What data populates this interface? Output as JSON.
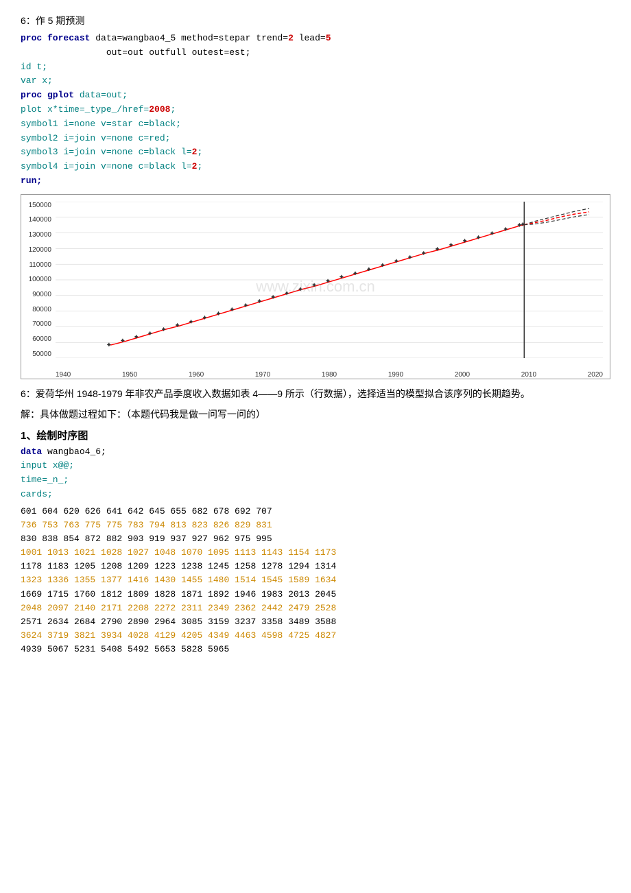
{
  "sections": {
    "section6_title": "6：作 5 期预测",
    "code1": {
      "line1": "proc forecast data=wangbao4_5 method=stepar trend=",
      "line1_val": "2",
      "line1_end": " lead=",
      "line1_val2": "5",
      "line2": "                out=out outfull outest=est;",
      "line3": "id t;",
      "line4": "var x;",
      "line5": "proc gplot data=out;",
      "line6": "plot x*time=_type_/href=",
      "line6_val": "2008",
      "line6_end": ";",
      "line7": "symbol1 i=none v=star c=black;",
      "line8": "symbol2 i=join v=none c=red;",
      "line9": "symbol3 i=join v=none c=black l=",
      "line9_val": "2",
      "line9_end": ";",
      "line10": "symbol4 i=join v=none c=black l=",
      "line10_val": "2",
      "line10_end": ";",
      "line11": "run;"
    },
    "chart": {
      "y_labels": [
        "150000",
        "140000",
        "130000",
        "120000",
        "110000",
        "100000",
        "90000",
        "80000",
        "70000",
        "60000",
        "50000"
      ],
      "x_labels": [
        "1940",
        "1950",
        "1960",
        "1970",
        "1980",
        "1990",
        "2000",
        "2010",
        "2020"
      ]
    },
    "section6b_text": "6：爱荷华州 1948-1979 年非农产品季度收入数据如表 4——9 所示（行数据），选择适当的模型拟合该序列的长期趋势。",
    "solution_text": "解：具体做题过程如下：（本题代码我是做一问写一问的）",
    "section1_title": "1、绘制时序图",
    "code2": {
      "line1": "data wangbao4_6;",
      "line2": "input x@@;",
      "line3": "time=_n_;",
      "line4": "cards;"
    },
    "data_rows": {
      "row1": "601  604  620  626  641  642  645  655  682  678  692  707",
      "row2": "736  753  763  775  775  783  794  813  823  826  829  831",
      "row3": "830  838  854  872  882  903  919  937  927  962  975  995",
      "row4": "1001 1013 1021 1028 1027 1048 1070 1095 1113 1143 1154 1173",
      "row5": "1178 1183 1205 1208 1209 1223 1238 1245 1258 1278 1294 1314",
      "row6": "1323 1336 1355 1377 1416 1430 1455 1480 1514 1545 1589 1634",
      "row7": "1669 1715 1760 1812 1809 1828 1871 1892 1946 1983 2013 2045",
      "row8": "2048 2097 2140 2171 2208 2272 2311 2349 2362 2442 2479 2528",
      "row9": "2571 2634 2684 2790 2890 2964 3085 3159 3237 3358 3489 3588",
      "row10": "3624 3719 3821 3934 4028 4129 4205 4349 4463 4598 4725 4827",
      "row11": "4939 5067 5231 5408 5492 5653 5828 5965"
    }
  }
}
